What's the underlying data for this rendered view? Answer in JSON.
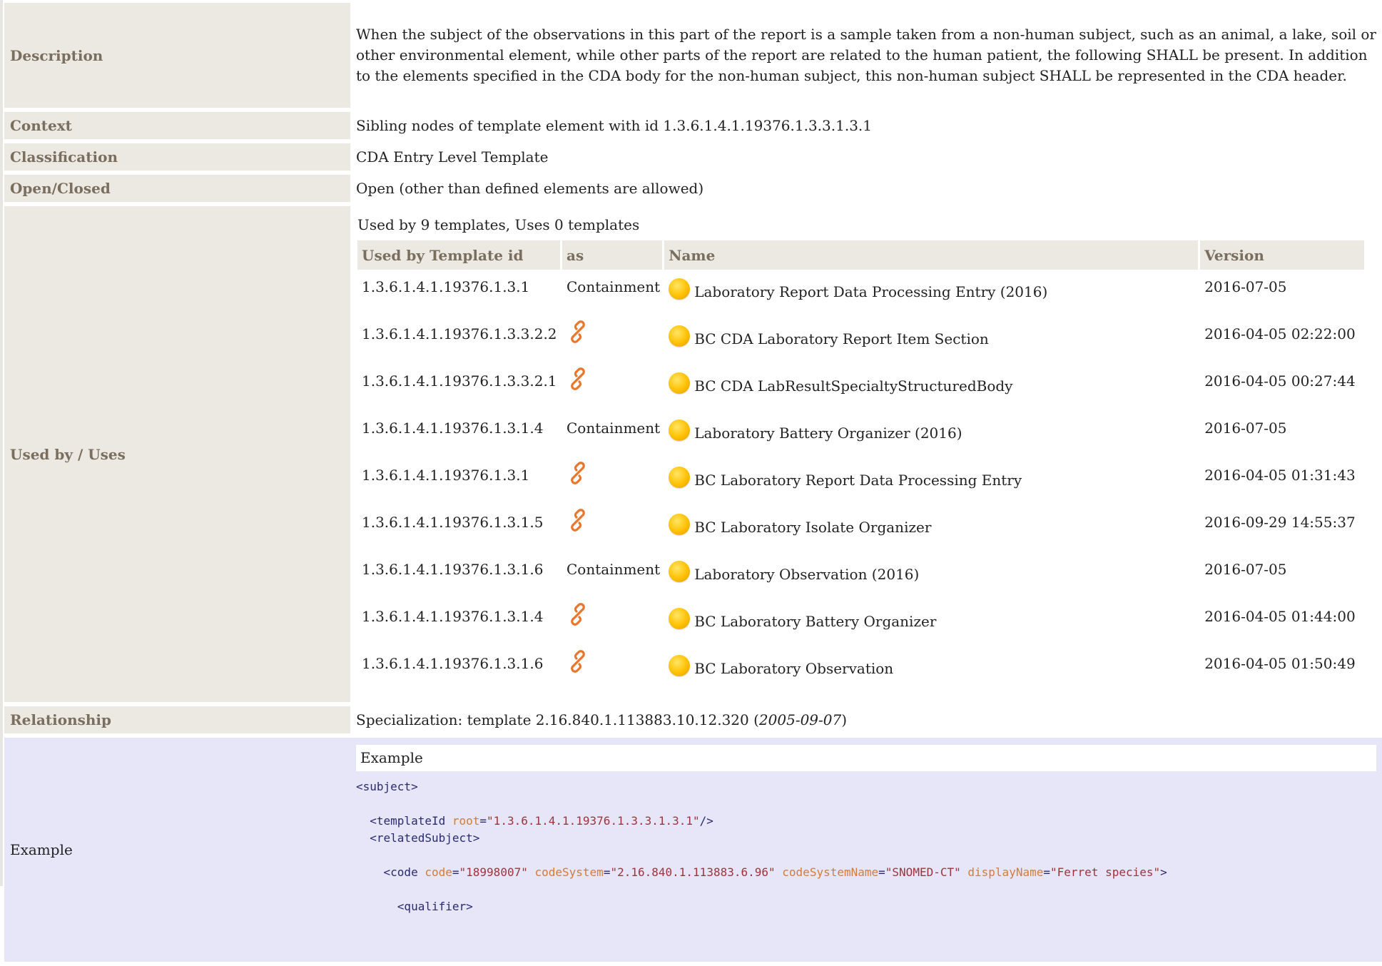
{
  "description": {
    "label": "Description",
    "text": "When the subject of the observations in this part of the report is a sample taken from a non-human subject, such as an animal, a lake, soil or other environmental element, while other parts of the report are related to the human patient, the following SHALL be present. In addition to the elements specified in the CDA body for the non-human subject, this non-human subject SHALL be represented in the CDA header."
  },
  "context": {
    "label": "Context",
    "text": "Sibling nodes of template element with id 1.3.6.1.4.1.19376.1.3.3.1.3.1"
  },
  "classification": {
    "label": "Classification",
    "text": "CDA Entry Level Template"
  },
  "open_closed": {
    "label": "Open/Closed",
    "text": "Open (other than defined elements are allowed)"
  },
  "used_by": {
    "label": "Used by / Uses",
    "summary": "Used by 9 templates, Uses 0 templates",
    "headers": [
      "Used by Template id",
      "as",
      "Name",
      "Version"
    ],
    "rows": [
      {
        "id": "1.3.6.1.4.1.19376.1.3.1",
        "as": "Containment",
        "as_icon": "",
        "name": "Laboratory Report Data Processing Entry (2016)",
        "version": "2016-07-05"
      },
      {
        "id": "1.3.6.1.4.1.19376.1.3.3.2.2",
        "as": "",
        "as_icon": "link-icon",
        "name": "BC CDA Laboratory Report Item Section",
        "version": "2016-04-05 02:22:00"
      },
      {
        "id": "1.3.6.1.4.1.19376.1.3.3.2.1",
        "as": "",
        "as_icon": "link-icon",
        "name": "BC CDA LabResultSpecialtyStructuredBody",
        "version": "2016-04-05 00:27:44"
      },
      {
        "id": "1.3.6.1.4.1.19376.1.3.1.4",
        "as": "Containment",
        "as_icon": "",
        "name": "Laboratory Battery Organizer (2016)",
        "version": "2016-07-05"
      },
      {
        "id": "1.3.6.1.4.1.19376.1.3.1",
        "as": "",
        "as_icon": "link-icon",
        "name": "BC Laboratory Report Data Processing Entry",
        "version": "2016-04-05 01:31:43"
      },
      {
        "id": "1.3.6.1.4.1.19376.1.3.1.5",
        "as": "",
        "as_icon": "link-icon",
        "name": "BC Laboratory Isolate Organizer",
        "version": "2016-09-29 14:55:37"
      },
      {
        "id": "1.3.6.1.4.1.19376.1.3.1.6",
        "as": "Containment",
        "as_icon": "",
        "name": "Laboratory Observation (2016)",
        "version": "2016-07-05"
      },
      {
        "id": "1.3.6.1.4.1.19376.1.3.1.4",
        "as": "",
        "as_icon": "link-icon",
        "name": "BC Laboratory Battery Organizer",
        "version": "2016-04-05 01:44:00"
      },
      {
        "id": "1.3.6.1.4.1.19376.1.3.1.6",
        "as": "",
        "as_icon": "link-icon",
        "name": "BC Laboratory Observation",
        "version": "2016-04-05 01:50:49"
      }
    ]
  },
  "relationship": {
    "label": "Relationship",
    "prefix": "Specialization: template 2.16.840.1.113883.10.12.320 (",
    "date": "2005-09-07",
    "suffix": ")"
  },
  "example": {
    "label": "Example",
    "header": "Example",
    "code": {
      "subject_open": "<subject>",
      "templateId_tag": "<templateId",
      "templateId_root_attr": "root",
      "templateId_root_val": "\"1.3.6.1.4.1.19376.1.3.3.1.3.1\"",
      "templateId_close": "/>",
      "relatedSubject_open": "<relatedSubject>",
      "code_tag": "<code",
      "code_attr": "code",
      "code_val": "\"18998007\"",
      "codeSystem_attr": "codeSystem",
      "codeSystem_val": "\"2.16.840.1.113883.6.96\"",
      "codeSystemName_attr": "codeSystemName",
      "codeSystemName_val": "\"SNOMED-CT\"",
      "displayName_attr": "displayName",
      "displayName_val": "\"Ferret species\"",
      "code_close": ">",
      "qualifier_open": "<qualifier>"
    }
  }
}
